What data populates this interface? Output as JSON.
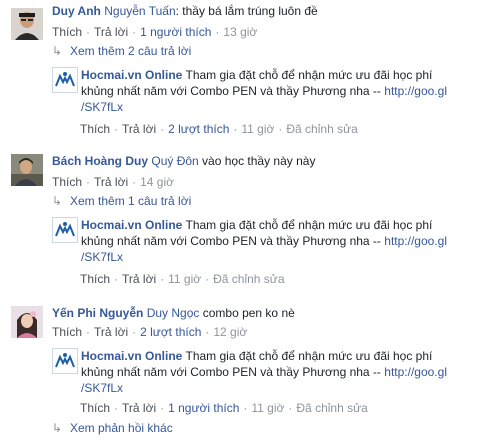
{
  "comments": [
    {
      "author": "Duy Anh",
      "tagged": "Nguyễn Tuấn",
      "text": ": thầy bá lắm trúng luôn đề",
      "actions": {
        "like": "Thích",
        "reply": "Trả lời",
        "likes": "1 người thích",
        "time": "13 giờ"
      },
      "more_replies": "Xem thêm 2 câu trả lời",
      "reply": {
        "author": "Hocmai.vn Online",
        "text_line1": "Tham gia đặt chỗ để nhận mức ưu đãi học phí",
        "text_line2": "khủng nhất năm với Combo PEN và thầy Phương nha -- ",
        "link_part1": "http://goo.gl",
        "link_part2": "/SK7fLx",
        "actions": {
          "like": "Thích",
          "reply": "Trả lời",
          "likes": "2 lượt thích",
          "time": "11 giờ",
          "edited": "Đã chỉnh sửa"
        }
      }
    },
    {
      "author": "Bách Hoàng Duy",
      "tagged": "Quý Đôn",
      "text": " vào học thầy này này",
      "actions": {
        "like": "Thích",
        "reply": "Trả lời",
        "time": "14 giờ"
      },
      "more_replies": "Xem thêm 1 câu trả lời",
      "reply": {
        "author": "Hocmai.vn Online",
        "text_line1": "Tham gia đặt chỗ để nhận mức ưu đãi học phí",
        "text_line2": "khủng nhất năm với Combo PEN và thầy Phương nha -- ",
        "link_part1": "http://goo.gl",
        "link_part2": "/SK7fLx",
        "actions": {
          "like": "Thích",
          "reply": "Trả lời",
          "time": "11 giờ",
          "edited": "Đã chỉnh sửa"
        }
      }
    },
    {
      "author": "Yến Phi Nguyễn",
      "tagged": "Duy Ngọc",
      "text": " combo pen ko nè",
      "actions": {
        "like": "Thích",
        "reply": "Trả lời",
        "likes": "2 lượt thích",
        "time": "12 giờ"
      },
      "reply": {
        "author": "Hocmai.vn Online",
        "text_line1": "Tham gia đặt chỗ để nhận mức ưu đãi học phí",
        "text_line2": "khủng nhất năm với Combo PEN và thầy Phương nha -- ",
        "link_part1": "http://goo.gl",
        "link_part2": "/SK7fLx",
        "actions": {
          "like": "Thích",
          "reply": "Trả lời",
          "likes": "1 người thích",
          "time": "11 giờ",
          "edited": "Đã chỉnh sửa"
        }
      }
    }
  ],
  "bottom_link": "Xem phản hồi khác",
  "icons": {
    "reply_arrow": "reply-arrow-icon"
  },
  "colors": {
    "link": "#365899",
    "meta": "#90949c",
    "text": "#1d2129"
  }
}
